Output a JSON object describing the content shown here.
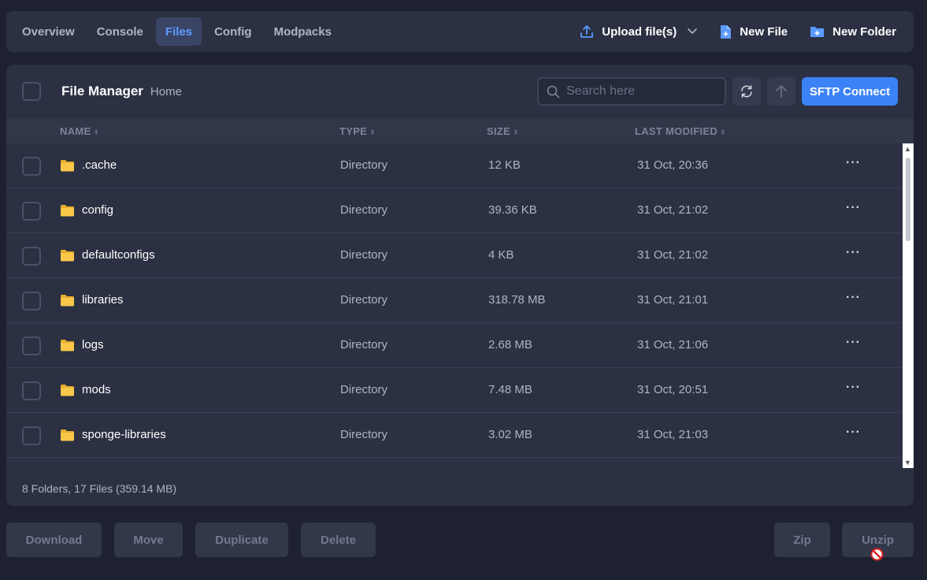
{
  "nav": {
    "tabs": [
      {
        "label": "Overview"
      },
      {
        "label": "Console"
      },
      {
        "label": "Files"
      },
      {
        "label": "Config"
      },
      {
        "label": "Modpacks"
      }
    ],
    "active_tab": "Files",
    "upload_label": "Upload file(s)",
    "new_file_label": "New File",
    "new_folder_label": "New Folder"
  },
  "file_manager": {
    "title": "File Manager",
    "breadcrumb": "Home",
    "search_placeholder": "Search here",
    "sftp_label": "SFTP Connect",
    "columns": {
      "name": "NAME",
      "type": "TYPE",
      "size": "SIZE",
      "modified": "LAST MODIFIED"
    },
    "rows": [
      {
        "name": ".cache",
        "type": "Directory",
        "size": "12 KB",
        "modified": "31 Oct, 20:36"
      },
      {
        "name": "config",
        "type": "Directory",
        "size": "39.36 KB",
        "modified": "31 Oct, 21:02"
      },
      {
        "name": "defaultconfigs",
        "type": "Directory",
        "size": "4 KB",
        "modified": "31 Oct, 21:02"
      },
      {
        "name": "libraries",
        "type": "Directory",
        "size": "318.78 MB",
        "modified": "31 Oct, 21:01"
      },
      {
        "name": "logs",
        "type": "Directory",
        "size": "2.68 MB",
        "modified": "31 Oct, 21:06"
      },
      {
        "name": "mods",
        "type": "Directory",
        "size": "7.48 MB",
        "modified": "31 Oct, 20:51"
      },
      {
        "name": "sponge-libraries",
        "type": "Directory",
        "size": "3.02 MB",
        "modified": "31 Oct, 21:03"
      }
    ],
    "summary": "8 Folders, 17 Files (359.14 MB)"
  },
  "bulk_actions": {
    "download": "Download",
    "move": "Move",
    "duplicate": "Duplicate",
    "delete": "Delete",
    "zip": "Zip",
    "unzip": "Unzip"
  },
  "colors": {
    "accent": "#3b82f6",
    "folder": "#f9c84a",
    "background": "#1e2230",
    "panel": "#2b3042"
  }
}
